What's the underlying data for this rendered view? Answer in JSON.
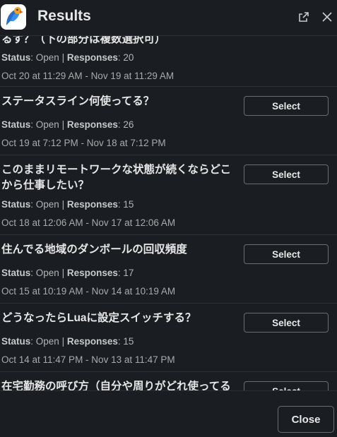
{
  "header": {
    "title": "Results",
    "open_icon": "external-link-icon",
    "close_icon": "close-icon",
    "app_icon": "parrot-logo"
  },
  "items": [
    {
      "question": "るす？（下の部分は複数選択可）",
      "status_label": "Status",
      "status_value": "Open",
      "responses_label": "Responses",
      "responses_value": "20",
      "dates": "Oct 20 at 11:29 AM - Nov 19 at 11:29 AM",
      "button": ""
    },
    {
      "question": "ステータスライン何使ってる？",
      "status_label": "Status",
      "status_value": "Open",
      "responses_label": "Responses",
      "responses_value": "26",
      "dates": "Oct 19 at 7:12 PM - Nov 18 at 7:12 PM",
      "button": "Select"
    },
    {
      "question": "このままリモートワークな状態が続くならどこから仕事したい？",
      "status_label": "Status",
      "status_value": "Open",
      "responses_label": "Responses",
      "responses_value": "15",
      "dates": "Oct 18 at 12:06 AM - Nov 17 at 12:06 AM",
      "button": "Select"
    },
    {
      "question": "住んでる地域のダンボールの回収頻度",
      "status_label": "Status",
      "status_value": "Open",
      "responses_label": "Responses",
      "responses_value": "17",
      "dates": "Oct 15 at 10:19 AM - Nov 14 at 10:19 AM",
      "button": "Select"
    },
    {
      "question": "どうなったらLuaに設定スイッチする？",
      "status_label": "Status",
      "status_value": "Open",
      "responses_label": "Responses",
      "responses_value": "15",
      "dates": "Oct 14 at 11:47 PM - Nov 13 at 11:47 PM",
      "button": "Select"
    },
    {
      "question": "在宅勤務の呼び方（自分や周りがどれ使ってる",
      "status_label": "",
      "status_value": "",
      "responses_label": "",
      "responses_value": "",
      "dates": "",
      "button": "Select"
    }
  ],
  "footer": {
    "close_label": "Close"
  },
  "colors": {
    "background": "#1a1d21",
    "divider": "#2f3237",
    "button_border": "#6b6d70",
    "text": "#e6e6e6"
  }
}
